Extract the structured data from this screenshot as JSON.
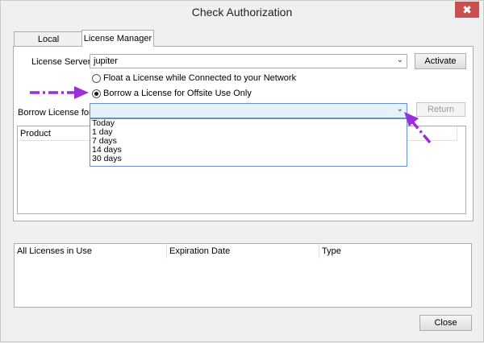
{
  "window": {
    "title": "Check Authorization",
    "close_glyph": "✖"
  },
  "tabs": [
    {
      "label": "Local",
      "active": false
    },
    {
      "label": "License Manager",
      "active": true
    }
  ],
  "license_server": {
    "label": "License Server",
    "value": "jupiter"
  },
  "activate_button": "Activate",
  "radio_float": {
    "label": "Float a License while Connected to your Network",
    "checked": false
  },
  "radio_borrow": {
    "label": "Borrow a License for Offsite Use Only",
    "checked": true
  },
  "borrow": {
    "label": "Borrow License for",
    "value": ""
  },
  "return_button": "Return",
  "borrow_options": [
    "Today",
    "1 day",
    "7 days",
    "14 days",
    "30 days"
  ],
  "product_table": {
    "headers": [
      "Product"
    ]
  },
  "licenses_table": {
    "headers": [
      "All Licenses in Use",
      "Expiration Date",
      "Type"
    ]
  },
  "close_button": "Close",
  "colors": {
    "annotation_arrow": "#9b30d9",
    "dropdown_border": "#6a8fc7",
    "close_x": "#c75050"
  },
  "icons": [
    "close-icon",
    "chevron-down-icon",
    "dash-arrow-right-icon",
    "dash-arrow-upleft-icon"
  ]
}
